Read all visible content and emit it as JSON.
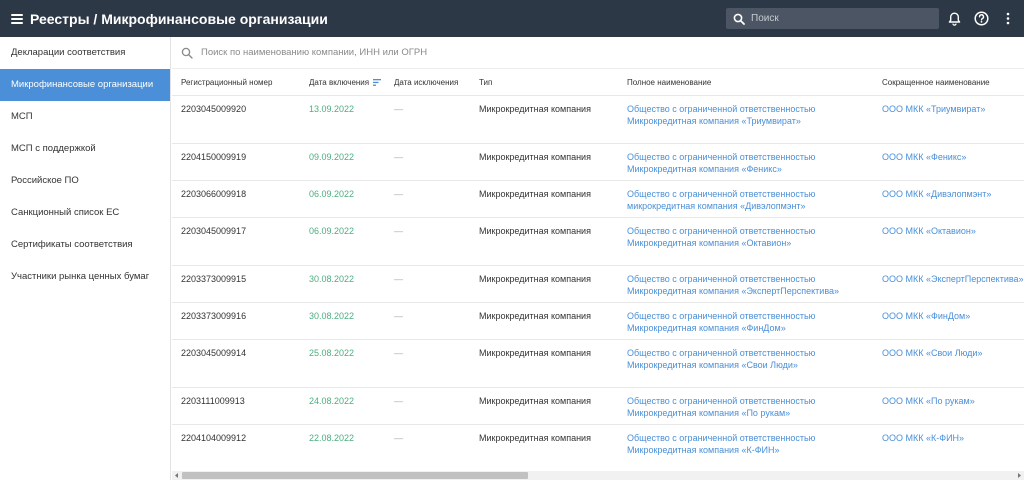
{
  "header": {
    "title": "Реестры / Микрофинансовые организации",
    "search_placeholder": "Поиск",
    "icons": [
      "menu-icon",
      "search-icon",
      "bell-icon",
      "help-icon",
      "more-vertical-icon"
    ]
  },
  "sidebar": {
    "items": [
      {
        "label": "Декларации соответствия",
        "active": false
      },
      {
        "label": "Микрофинансовые организации",
        "active": true
      },
      {
        "label": "МСП",
        "active": false
      },
      {
        "label": "МСП с поддержкой",
        "active": false
      },
      {
        "label": "Российское ПО",
        "active": false
      },
      {
        "label": "Санкционный список ЕС",
        "active": false
      },
      {
        "label": "Сертификаты соответствия",
        "active": false
      },
      {
        "label": "Участники рынка ценных бумаг",
        "active": false
      }
    ]
  },
  "filter": {
    "placeholder": "Поиск по наименованию компании, ИНН или ОГРН"
  },
  "table": {
    "columns": {
      "reg": "Регистрационный номер",
      "date_in": "Дата включения",
      "date_out": "Дата исключения",
      "type": "Тип",
      "full_name": "Полное наименование",
      "short_name": "Сокращенное наименование"
    },
    "rows": [
      {
        "reg": "2203045009920",
        "date_in": "13.09.2022",
        "date_out": "—",
        "type": "Микрокредитная компания",
        "full1": "Общество с ограниченной ответственностью",
        "full2": "Микрокредитная компания «Триумвират»",
        "short": "ООО МКК «Триумвират»"
      },
      {
        "reg": "2204150009919",
        "date_in": "09.09.2022",
        "date_out": "—",
        "type": "Микрокредитная компания",
        "full1": "Общество с ограниченной ответственностью",
        "full2": "Микрокредитная компания «Феникс»",
        "short": "ООО МКК «Феникс»"
      },
      {
        "reg": "2203066009918",
        "date_in": "06.09.2022",
        "date_out": "—",
        "type": "Микрокредитная компания",
        "full1": "Общество с ограниченной ответственностью",
        "full2": "микрокредитная компания «Дивэлопмэнт»",
        "short": "ООО МКК «Дивэлопмэнт»"
      },
      {
        "reg": "2203045009917",
        "date_in": "06.09.2022",
        "date_out": "—",
        "type": "Микрокредитная компания",
        "full1": "Общество с ограниченной ответственностью",
        "full2": "Микрокредитная компания «Октавион»",
        "short": "ООО МКК «Октавион»"
      },
      {
        "reg": "2203373009915",
        "date_in": "30.08.2022",
        "date_out": "—",
        "type": "Микрокредитная компания",
        "full1": "Общество с ограниченной ответственностью",
        "full2": "Микрокредитная компания «ЭкспертПерспектива»",
        "short": "ООО МКК «ЭкспертПерспектива»"
      },
      {
        "reg": "2203373009916",
        "date_in": "30.08.2022",
        "date_out": "—",
        "type": "Микрокредитная компания",
        "full1": "Общество с ограниченной ответственностью",
        "full2": "Микрокредитная компания «ФинДом»",
        "short": "ООО МКК «ФинДом»"
      },
      {
        "reg": "2203045009914",
        "date_in": "25.08.2022",
        "date_out": "—",
        "type": "Микрокредитная компания",
        "full1": "Общество с ограниченной ответственностью",
        "full2": "Микрокредитная компания «Свои Люди»",
        "short": "ООО МКК «Свои Люди»"
      },
      {
        "reg": "2203111009913",
        "date_in": "24.08.2022",
        "date_out": "—",
        "type": "Микрокредитная компания",
        "full1": "Общество с ограниченной ответственностью",
        "full2": "Микрокредитная компания «По рукам»",
        "short": "ООО МКК «По рукам»"
      },
      {
        "reg": "2204104009912",
        "date_in": "22.08.2022",
        "date_out": "—",
        "type": "Микрокредитная компания",
        "full1": "Общество с ограниченной ответственностью",
        "full2": "Микрокредитная компания «К-ФИН»",
        "short": "ООО МКК «К-ФИН»"
      }
    ]
  },
  "colors": {
    "header_bg": "#2d3846",
    "active_item_bg": "#4a8fd8",
    "link": "#4a8fd8",
    "date": "#4cae7f"
  }
}
